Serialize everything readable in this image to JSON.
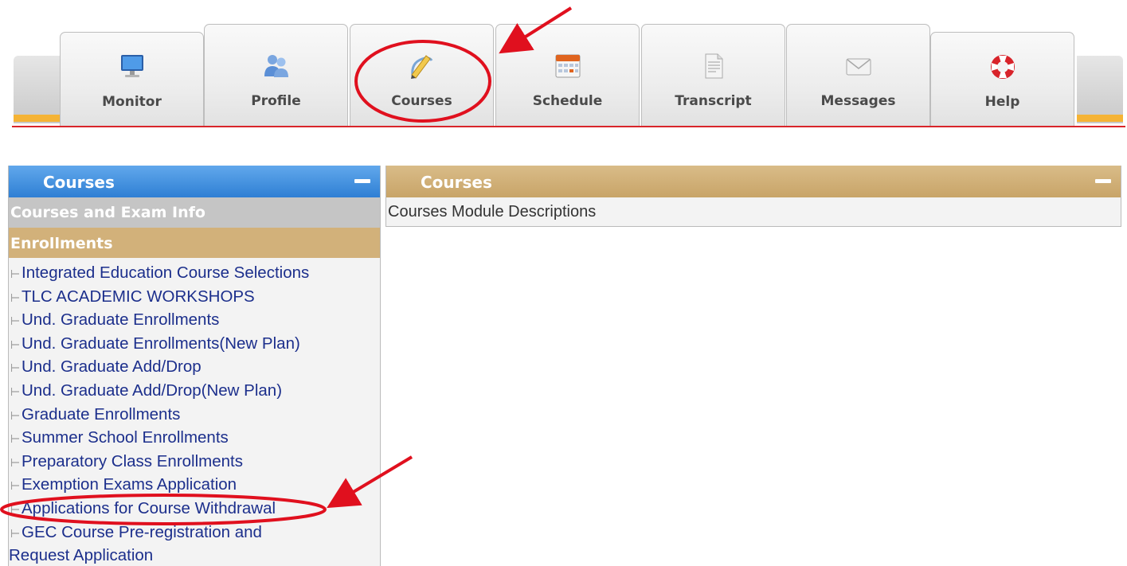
{
  "tabs": {
    "monitor": "Monitor",
    "profile": "Profile",
    "courses": "Courses",
    "schedule": "Schedule",
    "transcript": "Transcript",
    "messages": "Messages",
    "help": "Help"
  },
  "left_panel": {
    "title": "Courses",
    "section_courses_exam": "Courses and Exam Info",
    "section_enrollments": "Enrollments",
    "items": [
      "Integrated Education Course Selections",
      "TLC ACADEMIC WORKSHOPS",
      "Und. Graduate Enrollments",
      "Und. Graduate Enrollments(New Plan)",
      "Und. Graduate Add/Drop",
      "Und. Graduate Add/Drop(New Plan)",
      "Graduate Enrollments",
      "Summer School Enrollments",
      "Preparatory Class Enrollments",
      "Exemption Exams Application",
      "Applications for Course Withdrawal",
      "GEC Course Pre-registration and",
      "Request Application"
    ]
  },
  "right_panel": {
    "title": "Courses",
    "subtitle": "Courses Module Descriptions"
  },
  "colors": {
    "left_header": "#3a8ad9",
    "right_header": "#cfac72",
    "enrollments_bg": "#d2b17a",
    "link": "#1c2f8c",
    "annotation": "#e0101e"
  }
}
